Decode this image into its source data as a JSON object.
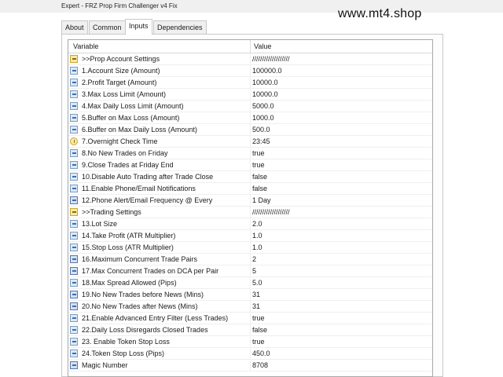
{
  "window": {
    "title": "Expert - FRZ Prop Firm Challenger v4 Fix"
  },
  "watermark": "www.mt4.shop",
  "tabs": [
    {
      "label": "About"
    },
    {
      "label": "Common"
    },
    {
      "label": "Inputs"
    },
    {
      "label": "Dependencies"
    }
  ],
  "table": {
    "col_variable": "Variable",
    "col_value": "Value",
    "rows": [
      {
        "icon": "ab-icon",
        "name": ">>Prop Account Settings",
        "value": "///////////////////"
      },
      {
        "icon": "number-icon",
        "name": "1.Account Size (Amount)",
        "value": "100000.0"
      },
      {
        "icon": "number-icon",
        "name": "2.Profit Target (Amount)",
        "value": "10000.0"
      },
      {
        "icon": "number-icon",
        "name": "3.Max Loss Limit (Amount)",
        "value": "10000.0"
      },
      {
        "icon": "number-icon",
        "name": "4.Max Daily Loss Limit (Amount)",
        "value": "5000.0"
      },
      {
        "icon": "number-icon",
        "name": "5.Buffer on Max Loss (Amount)",
        "value": "1000.0"
      },
      {
        "icon": "number-icon",
        "name": "6.Buffer on Max Daily Loss (Amount)",
        "value": "500.0"
      },
      {
        "icon": "clock-icon",
        "name": "7.Overnight Check Time",
        "value": "23:45"
      },
      {
        "icon": "bool-icon",
        "name": "8.No New Trades on Friday",
        "value": "true"
      },
      {
        "icon": "bool-icon",
        "name": "9.Close Trades at Friday End",
        "value": "true"
      },
      {
        "icon": "bool-icon",
        "name": "10.Disable Auto Trading after Trade Close",
        "value": "false"
      },
      {
        "icon": "bool-icon",
        "name": "11.Enable Phone/Email Notifications",
        "value": "false"
      },
      {
        "icon": "int-icon",
        "name": "12.Phone Alert/Email Frequency @ Every",
        "value": "1 Day"
      },
      {
        "icon": "ab-icon",
        "name": ">>Trading Settings",
        "value": "///////////////////"
      },
      {
        "icon": "number-icon",
        "name": "13.Lot Size",
        "value": "2.0"
      },
      {
        "icon": "number-icon",
        "name": "14.Take Profit (ATR Multiplier)",
        "value": "1.0"
      },
      {
        "icon": "number-icon",
        "name": "15.Stop Loss (ATR Multiplier)",
        "value": "1.0"
      },
      {
        "icon": "int-icon",
        "name": "16.Maximum Concurrent Trade Pairs",
        "value": "2"
      },
      {
        "icon": "int-icon",
        "name": "17.Max Concurrent Trades on DCA per Pair",
        "value": "5"
      },
      {
        "icon": "number-icon",
        "name": "18.Max Spread Allowed (Pips)",
        "value": "5.0"
      },
      {
        "icon": "int-icon",
        "name": "19.No New Trades before News (Mins)",
        "value": "31"
      },
      {
        "icon": "int-icon",
        "name": "20.No New Trades after News (Mins)",
        "value": "31"
      },
      {
        "icon": "bool-icon",
        "name": "21.Enable Advanced Entry Filter (Less Trades)",
        "value": "true"
      },
      {
        "icon": "bool-icon",
        "name": "22.Daily Loss Disregards Closed Trades",
        "value": "false"
      },
      {
        "icon": "bool-icon",
        "name": "23. Enable Token Stop Loss",
        "value": "true"
      },
      {
        "icon": "number-icon",
        "name": "24.Token Stop Loss (Pips)",
        "value": "450.0"
      },
      {
        "icon": "int-icon",
        "name": "Magic Number",
        "value": "8708"
      }
    ]
  }
}
